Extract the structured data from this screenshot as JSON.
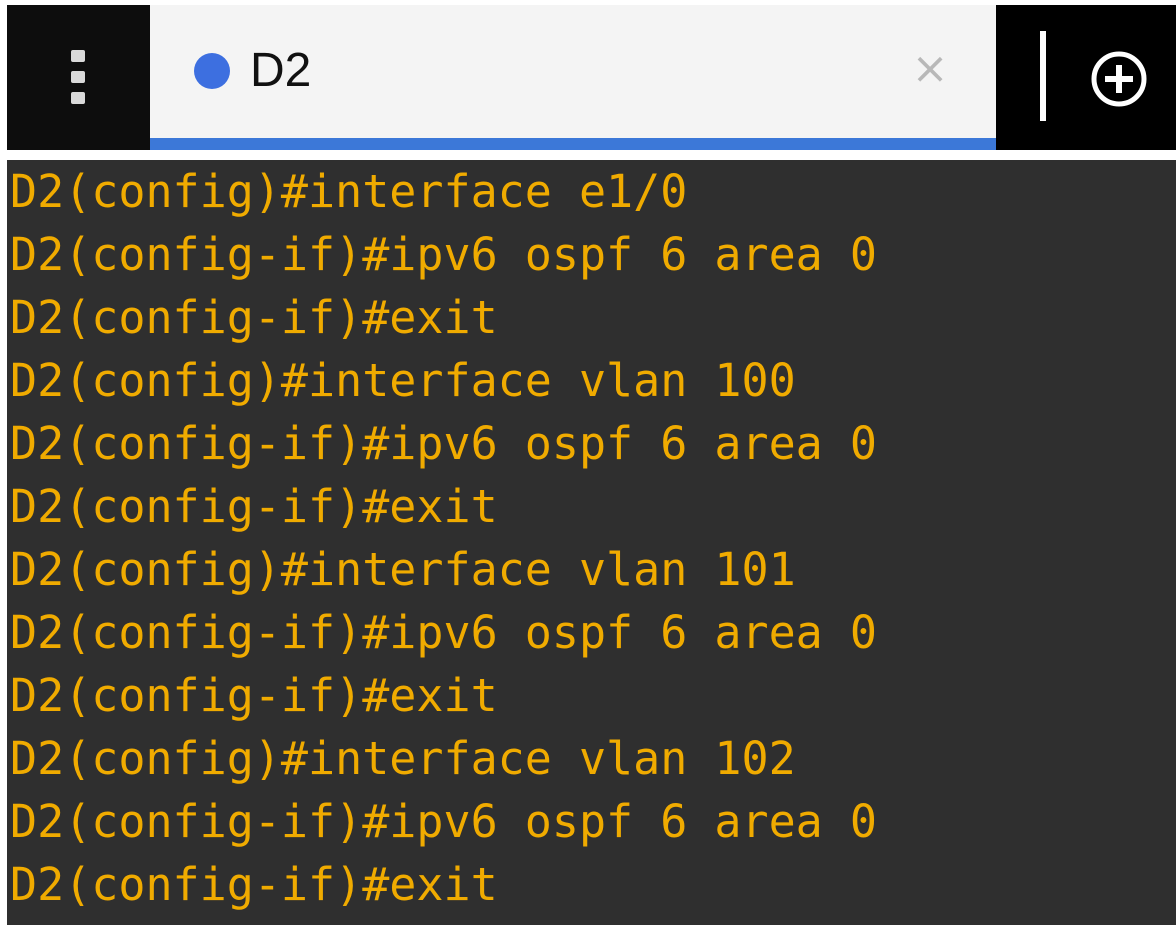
{
  "tab": {
    "title": "D2",
    "close_glyph": "×"
  },
  "icons": {
    "menu": "vertical-dots-icon",
    "status": "blue-dot-icon",
    "close": "close-icon",
    "new_tab": "plus-circle-icon"
  },
  "colors": {
    "tab_accent": "#3c78d8",
    "status_dot": "#3d6fe0",
    "terminal_background": "#2f2f2f",
    "terminal_text": "#f0ab00"
  },
  "terminal": {
    "lines": [
      "D2(config)#interface e1/0",
      "D2(config-if)#ipv6 ospf 6 area 0",
      "D2(config-if)#exit",
      "D2(config)#interface vlan 100",
      "D2(config-if)#ipv6 ospf 6 area 0",
      "D2(config-if)#exit",
      "D2(config)#interface vlan 101",
      "D2(config-if)#ipv6 ospf 6 area 0",
      "D2(config-if)#exit",
      "D2(config)#interface vlan 102",
      "D2(config-if)#ipv6 ospf 6 area 0",
      "D2(config-if)#exit"
    ]
  }
}
